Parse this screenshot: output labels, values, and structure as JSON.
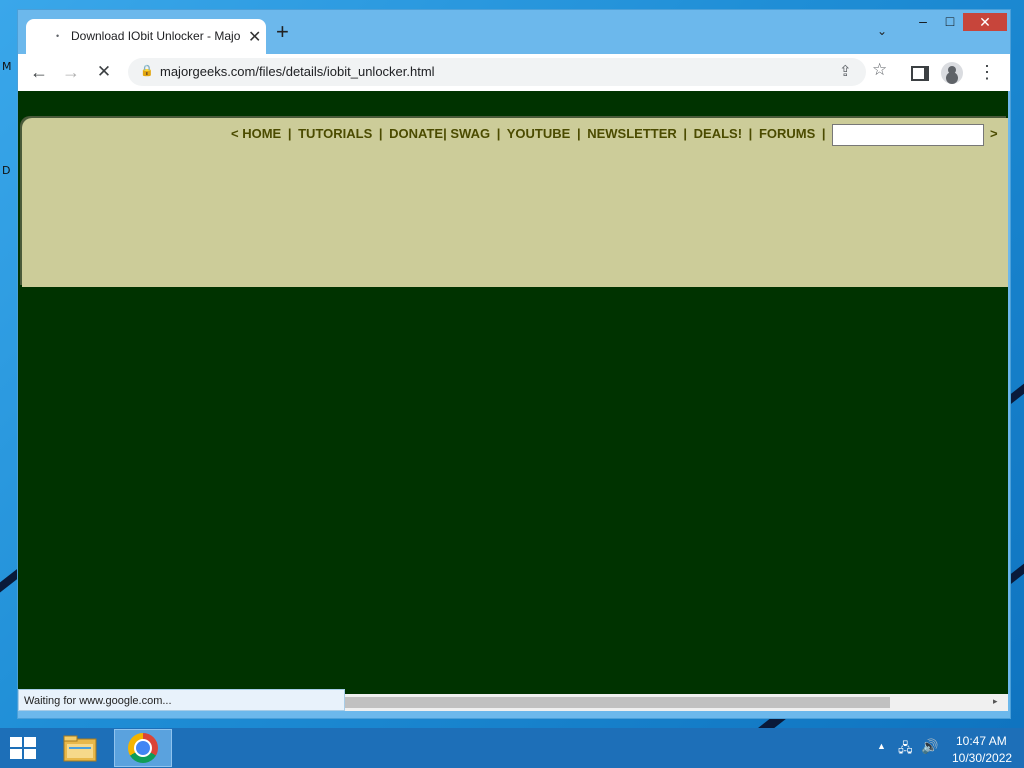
{
  "desktop": {
    "edge_glyphs": [
      "M",
      "D"
    ]
  },
  "browser": {
    "tab": {
      "title": "Download IObit Unlocker - Majo",
      "spinner": "•"
    },
    "new_tab": "+",
    "tab_search": "⌄",
    "window_controls": {
      "minimize": "–",
      "maximize": "□",
      "close": "✕"
    },
    "toolbar": {
      "back": "←",
      "forward": "→",
      "stop": "✕",
      "url": "majorgeeks.com/files/details/iobit_unlocker.html",
      "menu": "⋮"
    },
    "status_text": "Waiting for www.google.com...",
    "scroll_arrow": "▸"
  },
  "page": {
    "nav_open": "<",
    "nav_links": [
      "HOME",
      "TUTORIALS",
      "DONATE",
      "SWAG",
      "YOUTUBE",
      "NEWSLETTER",
      "DEALS!",
      "FORUMS"
    ],
    "nav_sep": "|",
    "nav_close": ">",
    "search_value": "",
    "colors": {
      "background": "#003300",
      "nav_bar": "#cccc99",
      "nav_text": "#4b4b00"
    }
  },
  "taskbar": {
    "icons": [
      "windows-start-icon",
      "file-explorer-icon",
      "chrome-icon"
    ],
    "tray": {
      "arrow": "▲",
      "network": "🖧",
      "volume": "🔊"
    },
    "clock_time": "10:47 AM",
    "clock_date": "10/30/2022"
  }
}
